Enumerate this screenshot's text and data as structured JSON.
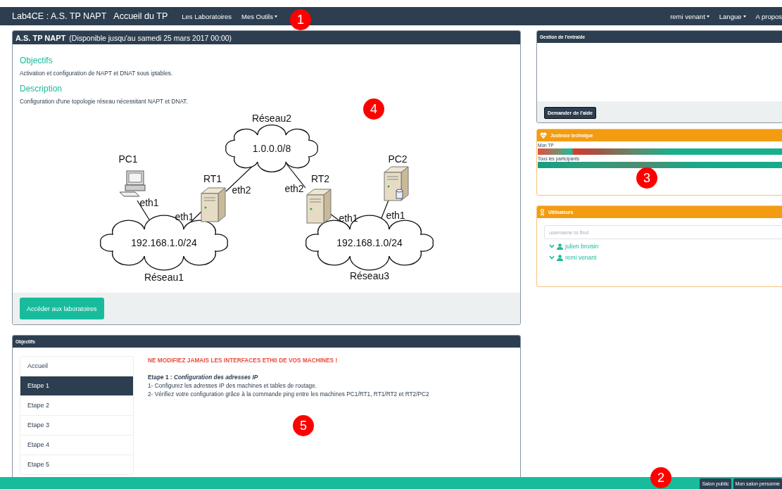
{
  "navbar": {
    "brand": "Lab4CE : A.S. TP NAPT",
    "title": "Accueil du TP",
    "items": [
      {
        "label": "Les Laboratoires",
        "dropdown": false
      },
      {
        "label": "Mes Outils",
        "dropdown": true
      }
    ],
    "right_items": [
      {
        "label": "remi venant",
        "dropdown": true
      },
      {
        "label": "Langue",
        "dropdown": true
      },
      {
        "label": "A propos",
        "dropdown": false
      }
    ]
  },
  "tp_panel": {
    "title": "A.S. TP NAPT",
    "availability": "(Disponible jusqu'au samedi 25 mars 2017 00:00)",
    "sections": [
      {
        "heading": "Objectifs",
        "text": "Activation et configuration de NAPT et DNAT sous iptables."
      },
      {
        "heading": "Description",
        "text": "Configuration d'une topologie réseau nécessitant NAPT et DNAT."
      }
    ],
    "diagram": {
      "networks": [
        {
          "name": "Réseau2",
          "address": "1.0.0.0/8"
        },
        {
          "name": "Réseau1",
          "address": "192.168.1.0/24"
        },
        {
          "name": "Réseau3",
          "address": "192.168.1.0/24"
        }
      ],
      "hosts": [
        {
          "name": "PC1",
          "kind": "pc"
        },
        {
          "name": "RT1",
          "kind": "server"
        },
        {
          "name": "RT2",
          "kind": "server"
        },
        {
          "name": "PC2",
          "kind": "storage-server"
        }
      ],
      "interfaces": [
        "eth1",
        "eth1",
        "eth2",
        "eth2",
        "eth1",
        "eth1"
      ]
    },
    "button": "Accéder aux laboratoires"
  },
  "steps_panel": {
    "title": "Objectifs",
    "steps": [
      {
        "label": "Accueil",
        "selected": false
      },
      {
        "label": "Etape 1",
        "selected": true
      },
      {
        "label": "Etape 2",
        "selected": false
      },
      {
        "label": "Etape 3",
        "selected": false
      },
      {
        "label": "Etape 4",
        "selected": false
      },
      {
        "label": "Etape 5",
        "selected": false
      }
    ],
    "warning": "NE MODIFIEZ JAMAIS LES INTERFACES ETH0 DE VOS MACHINES !",
    "step_title": "Etape 1 : *Configuration des adresses IP*",
    "lines": [
      "1- Configurez les adresses IP des machines et tables de routage.",
      "2- Vérifiez votre configuration grâce à la commande ping entre les machines PC1/RT1, RT1/RT2 et RT2/PC2"
    ]
  },
  "help_panel": {
    "title": "Gestion de l'entraide",
    "button": "Demander de l'aide"
  },
  "accuracy_panel": {
    "title": "Justesse technique",
    "meters": [
      {
        "label": "Mon TP",
        "kind": "mixed"
      },
      {
        "label": "Tous les participants",
        "kind": "good"
      }
    ]
  },
  "users_panel": {
    "title": "Utilisateurs",
    "search": {
      "placeholder": "username to find"
    },
    "users": [
      {
        "name": "julien broisin"
      },
      {
        "name": "remi venant"
      }
    ]
  },
  "footer": {
    "buttons": [
      "Salon public",
      "Mon salon personne"
    ]
  },
  "callouts": [
    "1",
    "2",
    "3",
    "4",
    "5"
  ]
}
